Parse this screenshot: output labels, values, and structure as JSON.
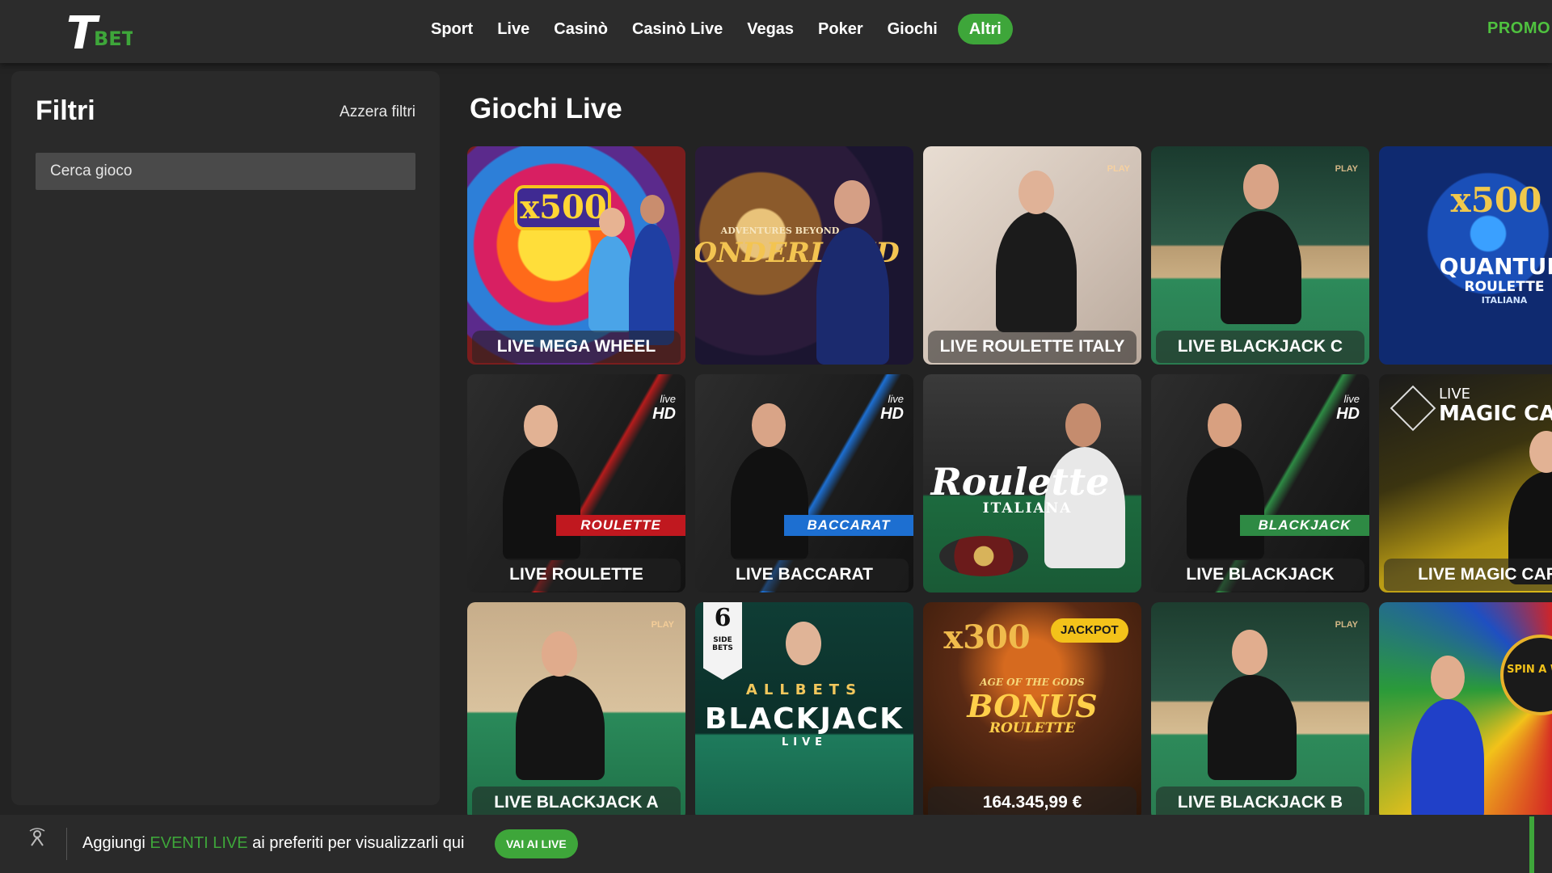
{
  "brand": {
    "logo_letter": "T",
    "logo_word": "BET",
    "accent": "#3ea63a"
  },
  "nav": {
    "items": [
      "Sport",
      "Live",
      "Casinò",
      "Casinò Live",
      "Vegas",
      "Poker",
      "Giochi"
    ],
    "active": "Altri",
    "promo": "PROMO"
  },
  "sidebar": {
    "title": "Filtri",
    "reset": "Azzera filtri",
    "search_placeholder": "Cerca gioco"
  },
  "main": {
    "title": "Giochi Live",
    "tiles": [
      {
        "label": "LIVE MEGA WHEEL",
        "art": "x500",
        "theme": "megawheel"
      },
      {
        "label": "",
        "art": "WONDERLAND",
        "art_sub": "ADVENTURES BEYOND",
        "theme": "wonderland"
      },
      {
        "label": "LIVE ROULETTE ITALY",
        "badge": "PLAY",
        "theme": "roulette-italy"
      },
      {
        "label": "LIVE BLACKJACK C",
        "badge": "PLAY",
        "theme": "blackjack-c"
      },
      {
        "label": "",
        "art": "x500",
        "art2": "QUANTUM",
        "art_sub": "ROULETTE",
        "art_sub2": "ITALIANA",
        "theme": "quantum"
      },
      {
        "label": "LIVE ROULETTE",
        "hd_top": "live",
        "hd": "HD",
        "strip": "ROULETTE",
        "theme": "live-roulette"
      },
      {
        "label": "LIVE BACCARAT",
        "hd_top": "live",
        "hd": "HD",
        "strip": "BACCARAT",
        "theme": "live-baccarat"
      },
      {
        "label": "",
        "art": "Roulette",
        "art_sub": "ITALIANA",
        "theme": "roulette-italiana"
      },
      {
        "label": "LIVE BLACKJACK",
        "hd_top": "live",
        "hd": "HD",
        "strip": "BLACKJACK",
        "theme": "live-blackjack"
      },
      {
        "label": "LIVE MAGIC CAR",
        "art_top": "LIVE",
        "art": "MAGIC CA",
        "theme": "magic"
      },
      {
        "label": "LIVE BLACKJACK A",
        "badge": "PLAY",
        "theme": "blackjack-a"
      },
      {
        "label": "",
        "art": "BLACKJACK",
        "art_sub": "LIVE",
        "art_top": "6",
        "art_top2": "SIDE BETS",
        "art_letters": "ALLBETS",
        "theme": "allbets"
      },
      {
        "label": "164.345,99 €",
        "jackpot": "JACKPOT",
        "art": "BONUS",
        "art_sub": "ROULETTE",
        "art_top": "x300",
        "art_top2": "AGE OF THE GODS",
        "theme": "bonus"
      },
      {
        "label": "LIVE BLACKJACK B",
        "badge": "PLAY",
        "theme": "blackjack-b"
      },
      {
        "label": "",
        "art": "SPIN A WIN",
        "theme": "spinwin"
      }
    ]
  },
  "bottombar": {
    "text_pre": "Aggiungi ",
    "text_accent": "EVENTI LIVE",
    "text_post": " ai preferiti per visualizzarli qui",
    "button": "VAI AI LIVE"
  }
}
